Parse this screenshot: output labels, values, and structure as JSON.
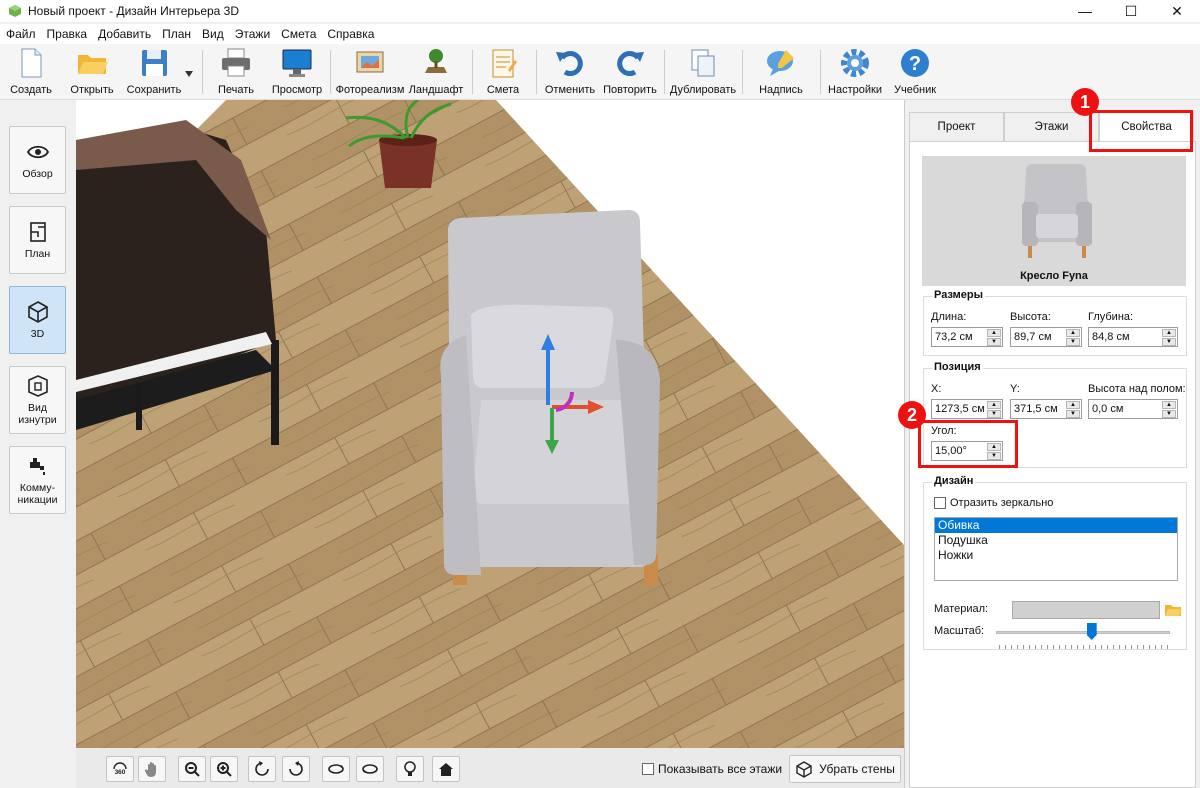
{
  "window": {
    "title": "Новый проект - Дизайн Интерьера 3D",
    "minimize": "—",
    "maximize": "☐",
    "close": "✕"
  },
  "menu": [
    "Файл",
    "Правка",
    "Добавить",
    "План",
    "Вид",
    "Этажи",
    "Смета",
    "Справка"
  ],
  "toolbar": {
    "create": "Создать",
    "open": "Открыть",
    "save": "Сохранить",
    "print": "Печать",
    "preview": "Просмотр",
    "photorealism": "Фотореализм",
    "landscape": "Ландшафт",
    "estimate": "Смета",
    "undo": "Отменить",
    "redo": "Повторить",
    "duplicate": "Дублировать",
    "caption": "Надпись",
    "settings": "Настройки",
    "tutorial": "Учебник"
  },
  "sidebar": {
    "overview": "Обзор",
    "plan": "План",
    "view3d": "3D",
    "inside_line1": "Вид",
    "inside_line2": "изнутри",
    "comm_line1": "Комму-",
    "comm_line2": "никации"
  },
  "bottombar": {
    "btn_360": "360",
    "show_all_floors": "Показывать все этажи",
    "remove_walls": "Убрать стены"
  },
  "tabs": {
    "project": "Проект",
    "floors": "Этажи",
    "properties": "Свойства"
  },
  "properties": {
    "object_name": "Кресло Fyna",
    "sizes": {
      "title": "Размеры",
      "length_label": "Длина:",
      "length_value": "73,2 см",
      "height_label": "Высота:",
      "height_value": "89,7 см",
      "depth_label": "Глубина:",
      "depth_value": "84,8 см"
    },
    "position": {
      "title": "Позиция",
      "x_label": "X:",
      "x_value": "1273,5 см",
      "y_label": "Y:",
      "y_value": "371,5 см",
      "elev_label": "Высота над полом:",
      "elev_value": "0,0 см",
      "angle_label": "Угол:",
      "angle_value": "15,00°"
    },
    "design": {
      "title": "Дизайн",
      "mirror_label": "Отразить зеркально",
      "parts": [
        "Обивка",
        "Подушка",
        "Ножки"
      ],
      "selected_part": "Обивка",
      "material_label": "Материал:",
      "scale_label": "Масштаб:",
      "scale_position": 0.55
    }
  },
  "callouts": {
    "first": "1",
    "second": "2",
    "color": "#e11111"
  },
  "colors": {
    "floor": "#b79a6e",
    "wall": "#ffffff",
    "accent": "#0078d7"
  }
}
